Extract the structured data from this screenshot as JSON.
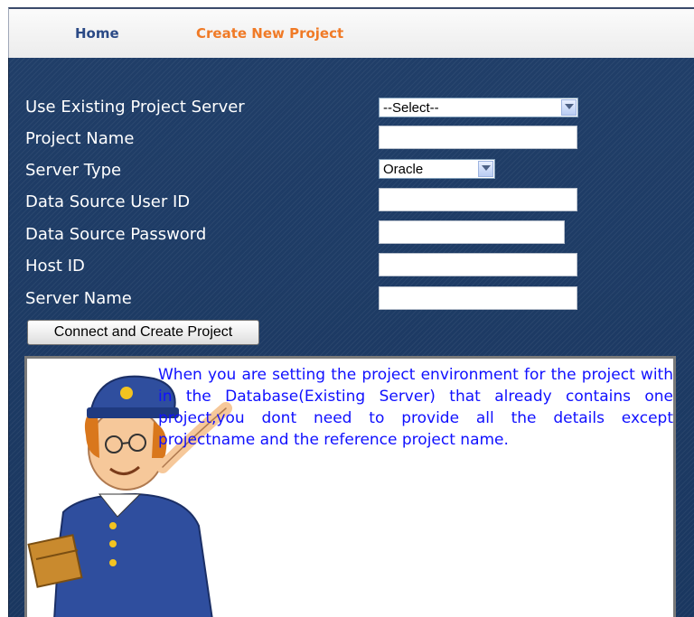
{
  "nav": {
    "home": "Home",
    "create": "Create New Project"
  },
  "form": {
    "existing_server_label": "Use Existing Project Server",
    "existing_server_value": "--Select--",
    "project_name_label": "Project Name",
    "server_type_label": "Server Type",
    "server_type_value": "Oracle",
    "ds_user_label": "Data Source User ID",
    "ds_password_label": "Data Source Password",
    "host_label": "Host ID",
    "server_name_label": "Server Name",
    "submit_label": "Connect and Create Project"
  },
  "info": {
    "text": "When you are setting the project environment for the project with in the Database(Existing Server) that already contains one project,you dont need to provide all the details except projectname and the reference project name."
  },
  "colors": {
    "panel_bg": "#1b3a62",
    "nav_home": "#2b4a86",
    "nav_active": "#f07a26",
    "info_text": "#1010ff"
  }
}
